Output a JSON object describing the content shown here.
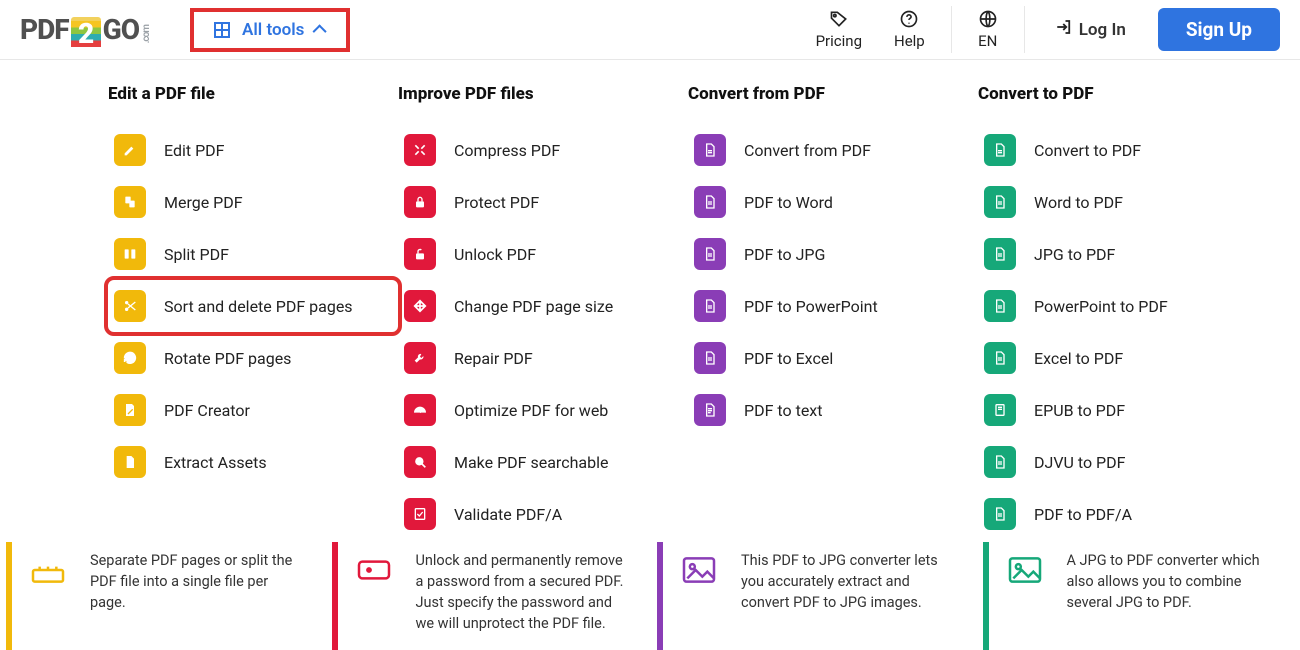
{
  "header": {
    "all_tools": "All tools",
    "pricing": "Pricing",
    "help": "Help",
    "lang": "EN",
    "login": "Log In",
    "signup": "Sign Up"
  },
  "columns": {
    "edit": {
      "title": "Edit a PDF file",
      "items": [
        "Edit PDF",
        "Merge PDF",
        "Split PDF",
        "Sort and delete PDF pages",
        "Rotate PDF pages",
        "PDF Creator",
        "Extract Assets"
      ]
    },
    "improve": {
      "title": "Improve PDF files",
      "items": [
        "Compress PDF",
        "Protect PDF",
        "Unlock PDF",
        "Change PDF page size",
        "Repair PDF",
        "Optimize PDF for web",
        "Make PDF searchable",
        "Validate PDF/A"
      ]
    },
    "from": {
      "title": "Convert from PDF",
      "items": [
        "Convert from PDF",
        "PDF to Word",
        "PDF to JPG",
        "PDF to PowerPoint",
        "PDF to Excel",
        "PDF to text"
      ]
    },
    "to": {
      "title": "Convert to PDF",
      "items": [
        "Convert to PDF",
        "Word to PDF",
        "JPG to PDF",
        "PowerPoint to PDF",
        "Excel to PDF",
        "EPUB to PDF",
        "DJVU to PDF",
        "PDF to PDF/A"
      ]
    }
  },
  "cards": {
    "c1": "Separate PDF pages or split the PDF file into a single file per page.",
    "c2": "Unlock and permanently remove a password from a secured PDF. Just specify the password and we will unprotect the PDF file.",
    "c3": "This PDF to JPG converter lets you accurately extract and convert PDF to JPG images.",
    "c4": "A JPG to PDF converter which also allows you to combine several JPG to PDF."
  }
}
